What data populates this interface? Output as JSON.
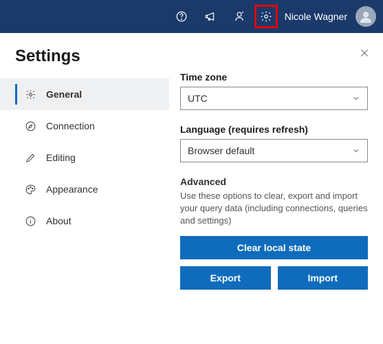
{
  "topbar": {
    "user_name": "Nicole Wagner"
  },
  "settings": {
    "title": "Settings",
    "nav": [
      {
        "label": "General"
      },
      {
        "label": "Connection"
      },
      {
        "label": "Editing"
      },
      {
        "label": "Appearance"
      },
      {
        "label": "About"
      }
    ]
  },
  "main": {
    "timezone_label": "Time zone",
    "timezone_value": "UTC",
    "language_label": "Language (requires refresh)",
    "language_value": "Browser default",
    "advanced_title": "Advanced",
    "advanced_desc": "Use these options to clear, export and import your query data (including connections, queries and settings)",
    "clear_btn": "Clear local state",
    "export_btn": "Export",
    "import_btn": "Import"
  }
}
